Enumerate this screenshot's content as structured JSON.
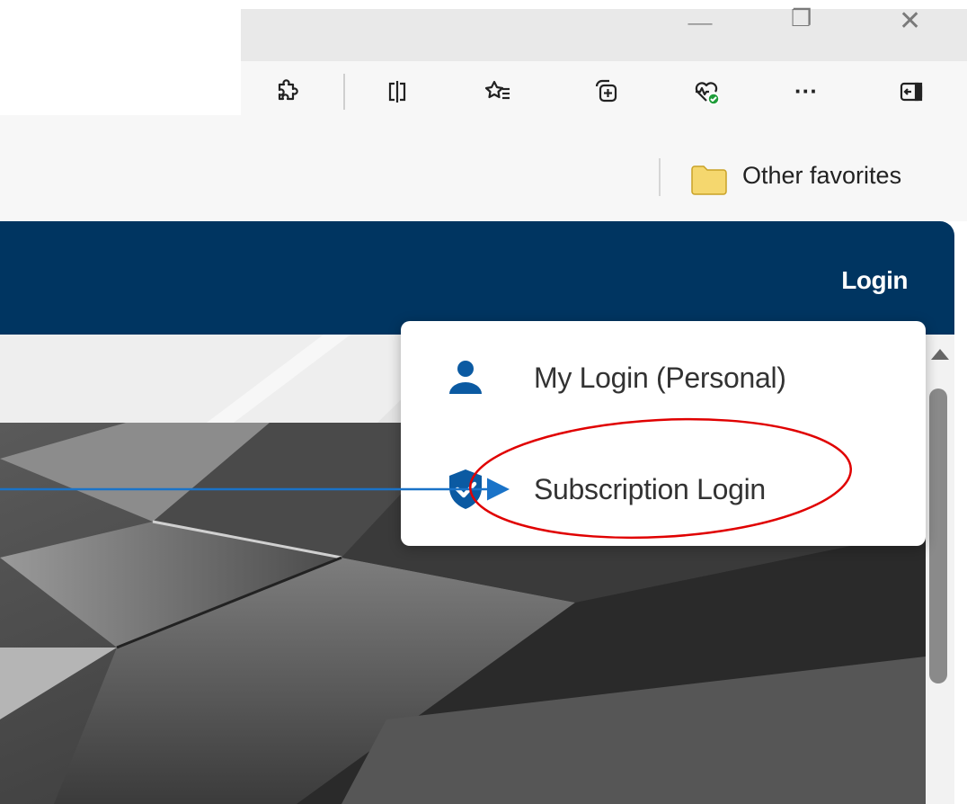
{
  "browser": {
    "window_controls": {
      "minimize": "—",
      "restore": "❐",
      "close": "✕"
    },
    "toolbar_icons": [
      "extensions-icon",
      "split-screen-icon",
      "favorites-icon",
      "collections-icon",
      "browser-essentials-icon",
      "more-icon",
      "sidebar-icon"
    ],
    "more_label": "···",
    "favorites_bar": {
      "other_favorites": "Other favorites"
    }
  },
  "site": {
    "nav": {
      "login": "Login"
    },
    "login_menu": {
      "items": [
        {
          "label": "My Login (Personal)",
          "icon": "person-icon"
        },
        {
          "label": "Subscription Login",
          "icon": "shield-check-icon"
        }
      ]
    }
  },
  "colors": {
    "nav_bg": "#003561",
    "icon_blue": "#0b5aa2",
    "annotation_arrow": "#1a73c8",
    "annotation_circle": "#e00000",
    "essentials_badge": "#1f9d3a",
    "folder_yellow": "#f5d76e"
  }
}
